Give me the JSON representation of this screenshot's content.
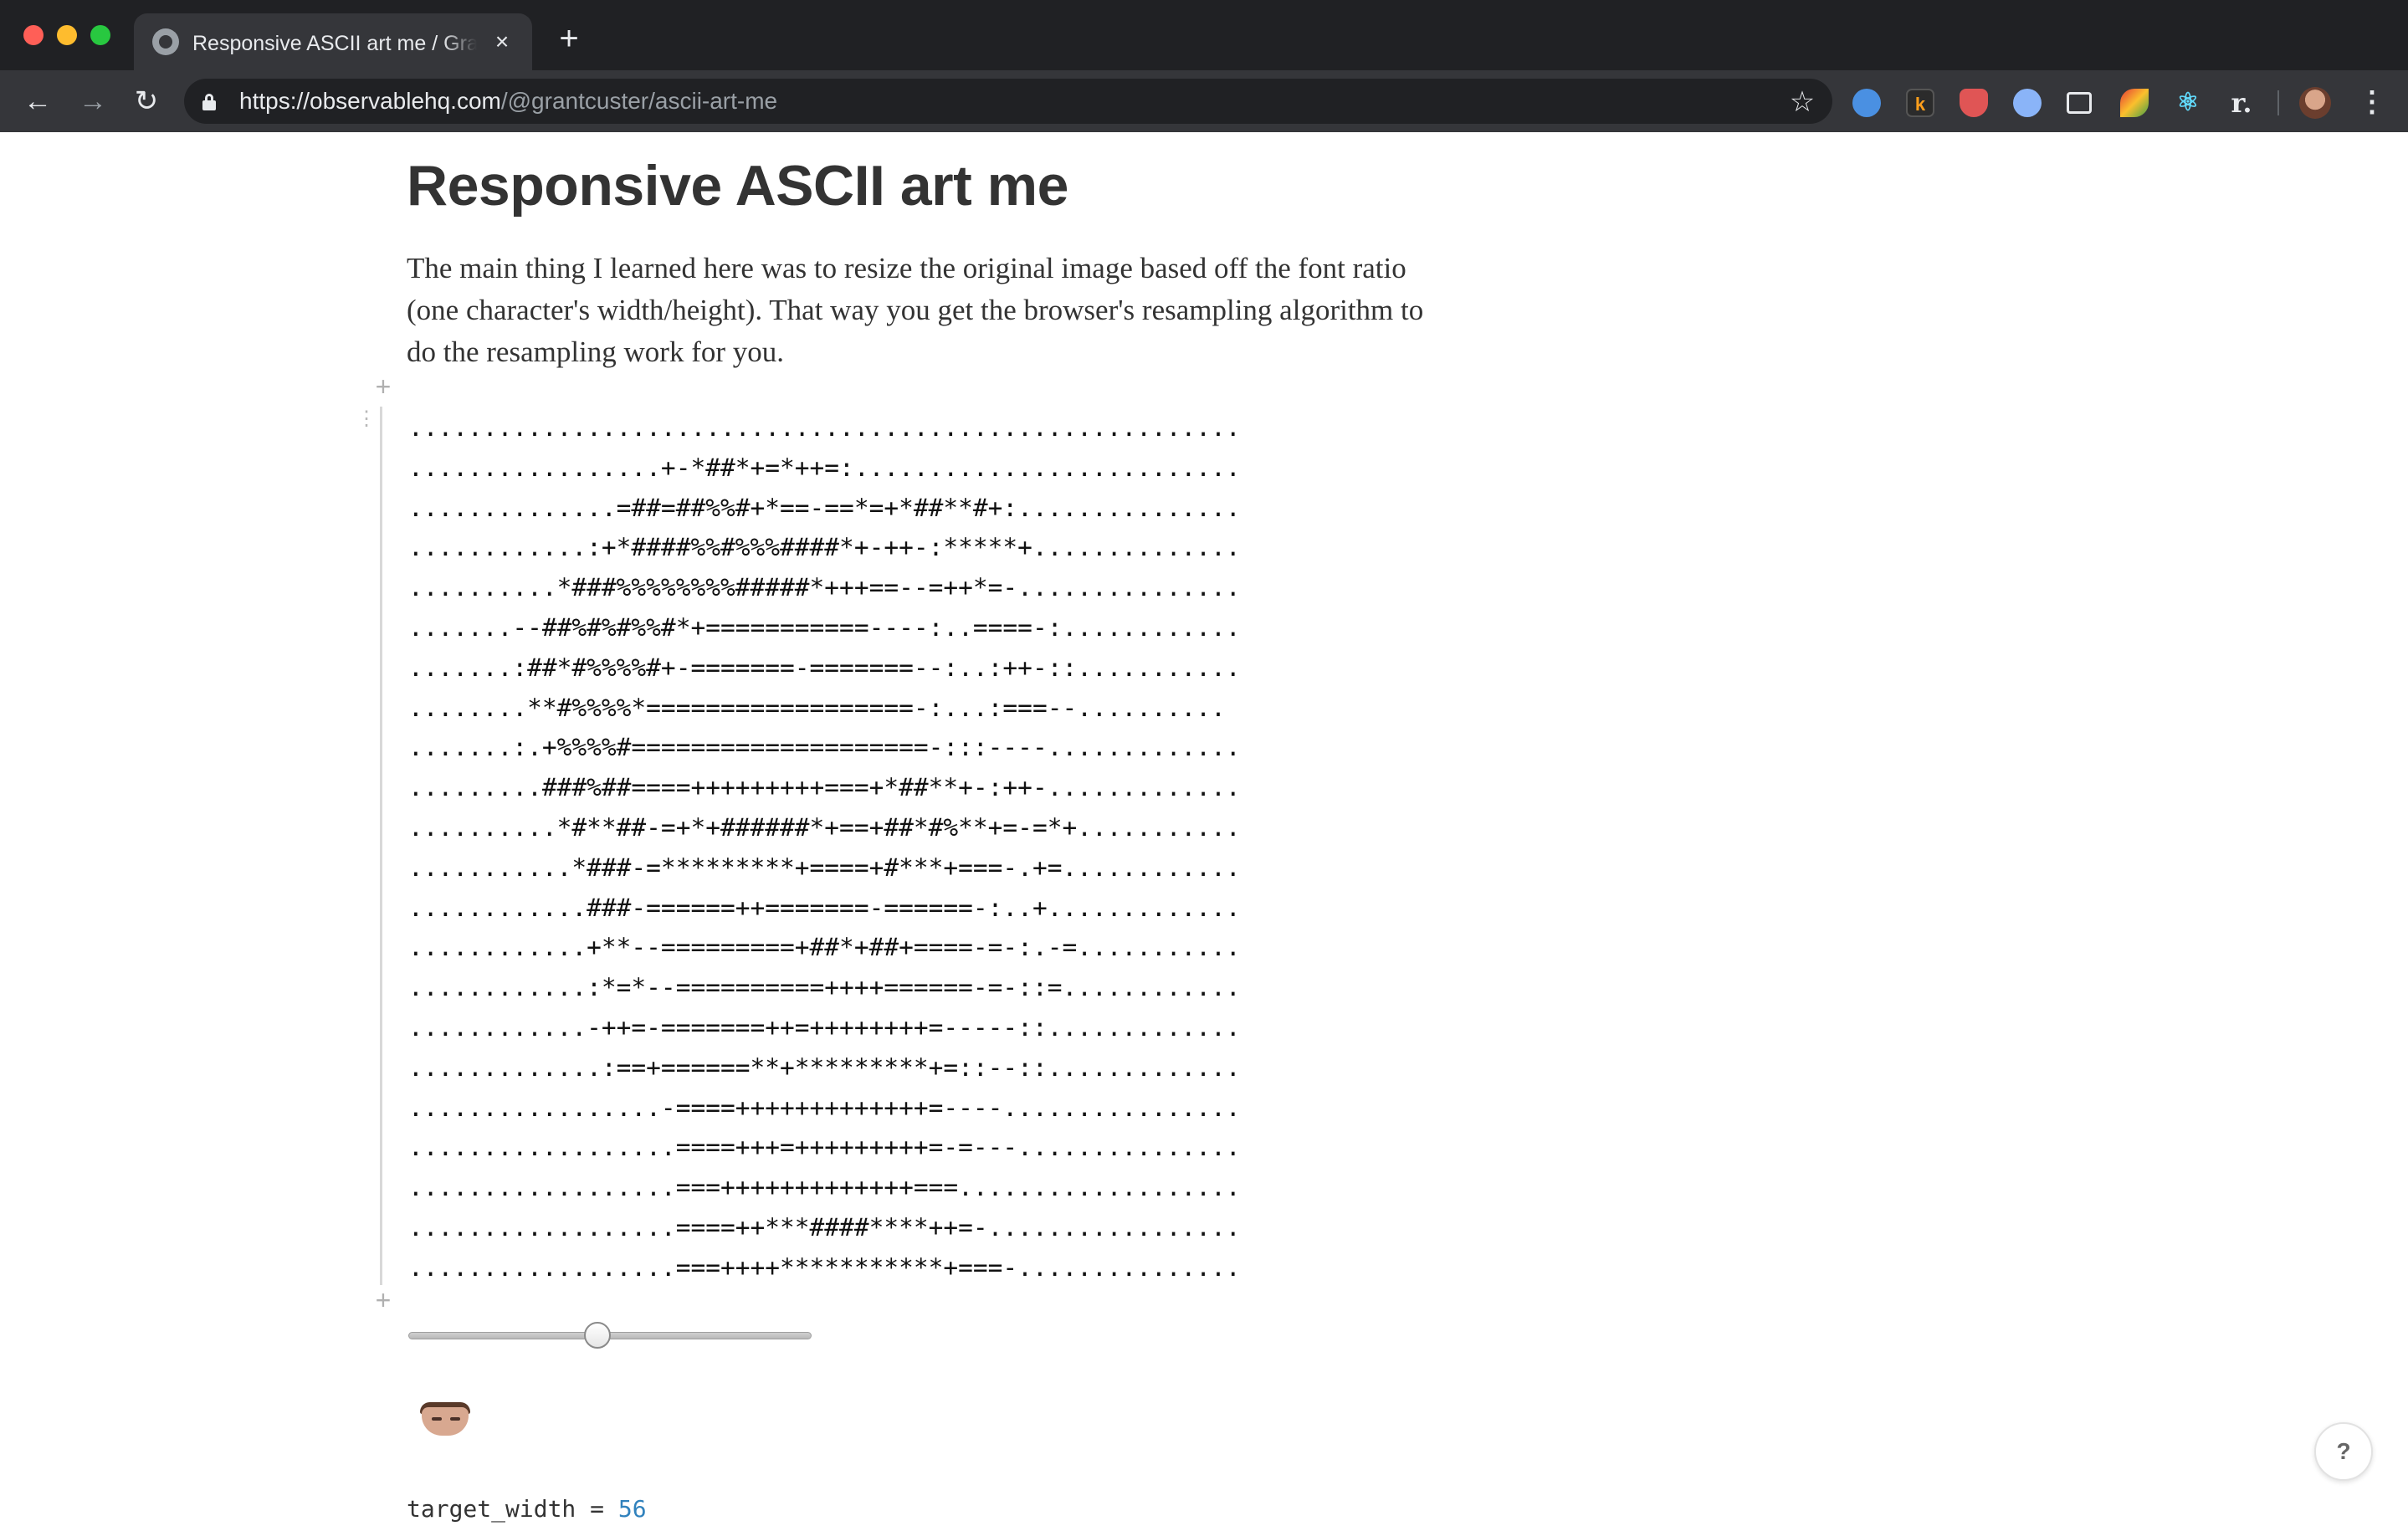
{
  "browser": {
    "tab_title": "Responsive ASCII art me / Grant Custer / Observable",
    "tab_close": "×",
    "new_tab": "+",
    "url_domain": "https://observablehq.com",
    "url_path": "/@grantcuster/ascii-art-me",
    "icons": {
      "back": "←",
      "forward": "→",
      "reload": "↻",
      "star": "☆",
      "menu": "⋮",
      "ext_k": "k",
      "ext_react": "⚛",
      "ext_r": "r."
    }
  },
  "page": {
    "title": "Responsive ASCII art me",
    "intro": "The main thing I learned here was to resize the original image based off the font ratio (one character's width/height). That way you get the browser's resampling algorithm to do the resampling work for you.",
    "cell_plus": "+",
    "cell_menu": "⋮",
    "ascii_lines": [
      "........................................................",
      ".................+-*##*+=*++=:..........................",
      "..............=##=##%%#+*==-==*=+*##**#+:...............",
      "............:+*####%%#%%%####*+-++-:*****+..............",
      "..........*###%%%%%%%%#####*+++==--=++*=-...............",
      ".......--##%#%#%%#*+===========----:..====-:............",
      ".......:##*#%%%%#+-=======-=======--:..:++-::...........",
      "........**#%%%%*==================-:...:===--..........",
      ".......:.+%%%%#====================-:::----.............",
      ".........###%##====+++++++++===+*##**+-:++-.............",
      "..........*#**##-=+*+######*+==+##*#%**+=-=*+...........",
      "...........*###-=*********+====+#***+===-.+=............",
      "............###-======++=======-======-:..+.............",
      "............+**--=========+##*+##+====-=-:.-=...........",
      "............:*=*--==========++++======-=-::=............",
      "............-++=-=======++=++++++++=-----::.............",
      ".............:==+======**+*********+=::--::.............",
      ".................-====+++++++++++++=----................",
      "..................====+++=+++++++++=-=---...............",
      "..................===+++++++++++++===...................",
      "..................====++***####****++=-.................",
      "..................===++++***********+===-..............."
    ],
    "code_name": "target_width = ",
    "code_value": "56",
    "slider_value": 0.47,
    "help_label": "?"
  },
  "colors": {
    "chrome_dark": "#202124",
    "chrome_toolbar": "#35363a",
    "text": "#333333",
    "code_number": "#3182bd"
  }
}
